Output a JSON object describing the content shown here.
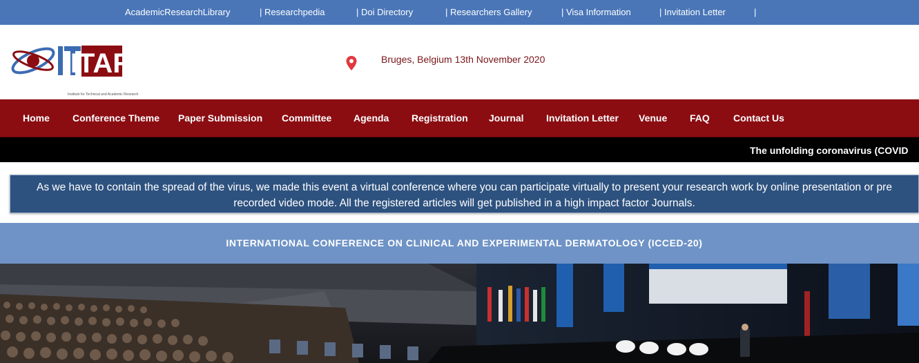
{
  "top_links": [
    "AcademicResearchLibrary",
    "| Researchpedia",
    "| Doi Directory",
    "| Researchers Gallery",
    "| Visa Information",
    "| Invitation Letter",
    "|"
  ],
  "logo": {
    "text": "ITAR",
    "tagline": "Institute for Technical and Academic Research"
  },
  "location": {
    "icon": "location-pin-icon",
    "text": "Bruges, Belgium 13th November 2020"
  },
  "nav": [
    "Home",
    "Conference Theme",
    "Paper Submission",
    "Committee",
    "Agenda",
    "Registration",
    "Journal",
    "Invitation Letter",
    "Venue",
    "FAQ",
    "Contact Us"
  ],
  "ticker": "The unfolding coronavirus (COVID",
  "notice": "As we have to contain the spread of the virus, we made this event a virtual conference where you can participate virtually to present your research work by online presentation or pre recorded video mode. All the registered articles will get published in a high impact factor Journals.",
  "conference_title": "INTERNATIONAL CONFERENCE ON CLINICAL AND EXPERIMENTAL DERMATOLOGY (ICCED-20)",
  "colors": {
    "top_bar": "#4a76b8",
    "nav_bar": "#8b0d12",
    "ticker": "#000000",
    "notice": "#2e527f",
    "title_band": "#6f93c6",
    "location_text": "#7a1418"
  }
}
